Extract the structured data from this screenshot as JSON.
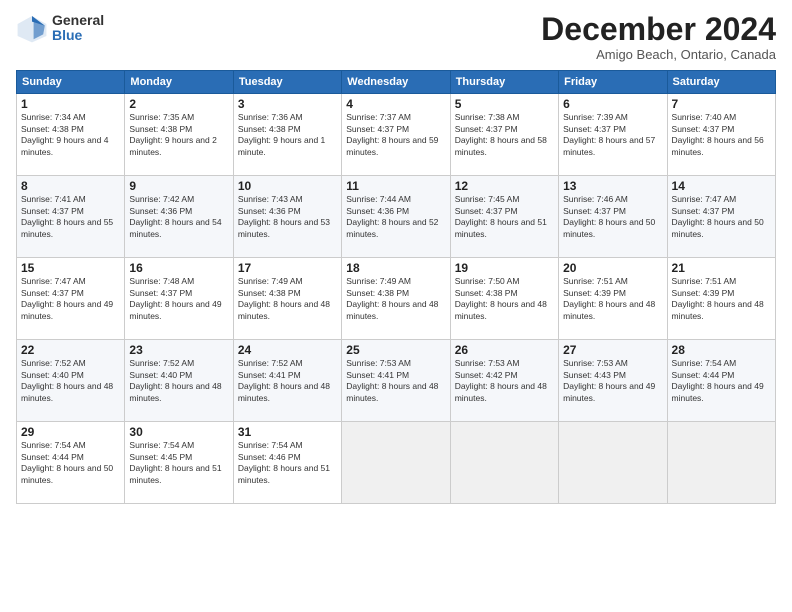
{
  "logo": {
    "general": "General",
    "blue": "Blue"
  },
  "header": {
    "month": "December 2024",
    "location": "Amigo Beach, Ontario, Canada"
  },
  "weekdays": [
    "Sunday",
    "Monday",
    "Tuesday",
    "Wednesday",
    "Thursday",
    "Friday",
    "Saturday"
  ],
  "weeks": [
    [
      {
        "day": "1",
        "sunrise": "Sunrise: 7:34 AM",
        "sunset": "Sunset: 4:38 PM",
        "daylight": "Daylight: 9 hours and 4 minutes."
      },
      {
        "day": "2",
        "sunrise": "Sunrise: 7:35 AM",
        "sunset": "Sunset: 4:38 PM",
        "daylight": "Daylight: 9 hours and 2 minutes."
      },
      {
        "day": "3",
        "sunrise": "Sunrise: 7:36 AM",
        "sunset": "Sunset: 4:38 PM",
        "daylight": "Daylight: 9 hours and 1 minute."
      },
      {
        "day": "4",
        "sunrise": "Sunrise: 7:37 AM",
        "sunset": "Sunset: 4:37 PM",
        "daylight": "Daylight: 8 hours and 59 minutes."
      },
      {
        "day": "5",
        "sunrise": "Sunrise: 7:38 AM",
        "sunset": "Sunset: 4:37 PM",
        "daylight": "Daylight: 8 hours and 58 minutes."
      },
      {
        "day": "6",
        "sunrise": "Sunrise: 7:39 AM",
        "sunset": "Sunset: 4:37 PM",
        "daylight": "Daylight: 8 hours and 57 minutes."
      },
      {
        "day": "7",
        "sunrise": "Sunrise: 7:40 AM",
        "sunset": "Sunset: 4:37 PM",
        "daylight": "Daylight: 8 hours and 56 minutes."
      }
    ],
    [
      {
        "day": "8",
        "sunrise": "Sunrise: 7:41 AM",
        "sunset": "Sunset: 4:37 PM",
        "daylight": "Daylight: 8 hours and 55 minutes."
      },
      {
        "day": "9",
        "sunrise": "Sunrise: 7:42 AM",
        "sunset": "Sunset: 4:36 PM",
        "daylight": "Daylight: 8 hours and 54 minutes."
      },
      {
        "day": "10",
        "sunrise": "Sunrise: 7:43 AM",
        "sunset": "Sunset: 4:36 PM",
        "daylight": "Daylight: 8 hours and 53 minutes."
      },
      {
        "day": "11",
        "sunrise": "Sunrise: 7:44 AM",
        "sunset": "Sunset: 4:36 PM",
        "daylight": "Daylight: 8 hours and 52 minutes."
      },
      {
        "day": "12",
        "sunrise": "Sunrise: 7:45 AM",
        "sunset": "Sunset: 4:37 PM",
        "daylight": "Daylight: 8 hours and 51 minutes."
      },
      {
        "day": "13",
        "sunrise": "Sunrise: 7:46 AM",
        "sunset": "Sunset: 4:37 PM",
        "daylight": "Daylight: 8 hours and 50 minutes."
      },
      {
        "day": "14",
        "sunrise": "Sunrise: 7:47 AM",
        "sunset": "Sunset: 4:37 PM",
        "daylight": "Daylight: 8 hours and 50 minutes."
      }
    ],
    [
      {
        "day": "15",
        "sunrise": "Sunrise: 7:47 AM",
        "sunset": "Sunset: 4:37 PM",
        "daylight": "Daylight: 8 hours and 49 minutes."
      },
      {
        "day": "16",
        "sunrise": "Sunrise: 7:48 AM",
        "sunset": "Sunset: 4:37 PM",
        "daylight": "Daylight: 8 hours and 49 minutes."
      },
      {
        "day": "17",
        "sunrise": "Sunrise: 7:49 AM",
        "sunset": "Sunset: 4:38 PM",
        "daylight": "Daylight: 8 hours and 48 minutes."
      },
      {
        "day": "18",
        "sunrise": "Sunrise: 7:49 AM",
        "sunset": "Sunset: 4:38 PM",
        "daylight": "Daylight: 8 hours and 48 minutes."
      },
      {
        "day": "19",
        "sunrise": "Sunrise: 7:50 AM",
        "sunset": "Sunset: 4:38 PM",
        "daylight": "Daylight: 8 hours and 48 minutes."
      },
      {
        "day": "20",
        "sunrise": "Sunrise: 7:51 AM",
        "sunset": "Sunset: 4:39 PM",
        "daylight": "Daylight: 8 hours and 48 minutes."
      },
      {
        "day": "21",
        "sunrise": "Sunrise: 7:51 AM",
        "sunset": "Sunset: 4:39 PM",
        "daylight": "Daylight: 8 hours and 48 minutes."
      }
    ],
    [
      {
        "day": "22",
        "sunrise": "Sunrise: 7:52 AM",
        "sunset": "Sunset: 4:40 PM",
        "daylight": "Daylight: 8 hours and 48 minutes."
      },
      {
        "day": "23",
        "sunrise": "Sunrise: 7:52 AM",
        "sunset": "Sunset: 4:40 PM",
        "daylight": "Daylight: 8 hours and 48 minutes."
      },
      {
        "day": "24",
        "sunrise": "Sunrise: 7:52 AM",
        "sunset": "Sunset: 4:41 PM",
        "daylight": "Daylight: 8 hours and 48 minutes."
      },
      {
        "day": "25",
        "sunrise": "Sunrise: 7:53 AM",
        "sunset": "Sunset: 4:41 PM",
        "daylight": "Daylight: 8 hours and 48 minutes."
      },
      {
        "day": "26",
        "sunrise": "Sunrise: 7:53 AM",
        "sunset": "Sunset: 4:42 PM",
        "daylight": "Daylight: 8 hours and 48 minutes."
      },
      {
        "day": "27",
        "sunrise": "Sunrise: 7:53 AM",
        "sunset": "Sunset: 4:43 PM",
        "daylight": "Daylight: 8 hours and 49 minutes."
      },
      {
        "day": "28",
        "sunrise": "Sunrise: 7:54 AM",
        "sunset": "Sunset: 4:44 PM",
        "daylight": "Daylight: 8 hours and 49 minutes."
      }
    ],
    [
      {
        "day": "29",
        "sunrise": "Sunrise: 7:54 AM",
        "sunset": "Sunset: 4:44 PM",
        "daylight": "Daylight: 8 hours and 50 minutes."
      },
      {
        "day": "30",
        "sunrise": "Sunrise: 7:54 AM",
        "sunset": "Sunset: 4:45 PM",
        "daylight": "Daylight: 8 hours and 51 minutes."
      },
      {
        "day": "31",
        "sunrise": "Sunrise: 7:54 AM",
        "sunset": "Sunset: 4:46 PM",
        "daylight": "Daylight: 8 hours and 51 minutes."
      },
      null,
      null,
      null,
      null
    ]
  ]
}
